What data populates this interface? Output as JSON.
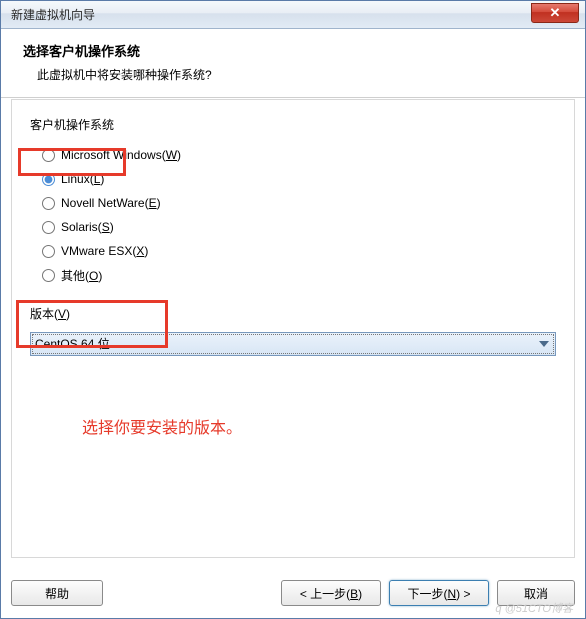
{
  "window": {
    "title": "新建虚拟机向导",
    "close_glyph": "✕"
  },
  "header": {
    "title": "选择客户机操作系统",
    "subtitle": "此虚拟机中将安装哪种操作系统?"
  },
  "os_group": {
    "label": "客户机操作系统",
    "options": [
      {
        "label_pre": "Microsoft Windows(",
        "key": "W",
        "label_post": ")",
        "checked": false
      },
      {
        "label_pre": "Linux(",
        "key": "L",
        "label_post": ")",
        "checked": true
      },
      {
        "label_pre": "Novell NetWare(",
        "key": "E",
        "label_post": ")",
        "checked": false
      },
      {
        "label_pre": "Solaris(",
        "key": "S",
        "label_post": ")",
        "checked": false
      },
      {
        "label_pre": "VMware ESX(",
        "key": "X",
        "label_post": ")",
        "checked": false
      },
      {
        "label_pre": "其他(",
        "key": "O",
        "label_post": ")",
        "checked": false
      }
    ]
  },
  "version": {
    "label_pre": "版本(",
    "key": "V",
    "label_post": ")",
    "selected": "CentOS 64 位"
  },
  "annotation": "选择你要安装的版本。",
  "footer": {
    "help": "帮助",
    "back_pre": "< 上一步(",
    "back_key": "B",
    "back_post": ")",
    "next_pre": "下一步(",
    "next_key": "N",
    "next_post": ") >",
    "cancel": "取消"
  },
  "watermark": "q @51CTO博客"
}
